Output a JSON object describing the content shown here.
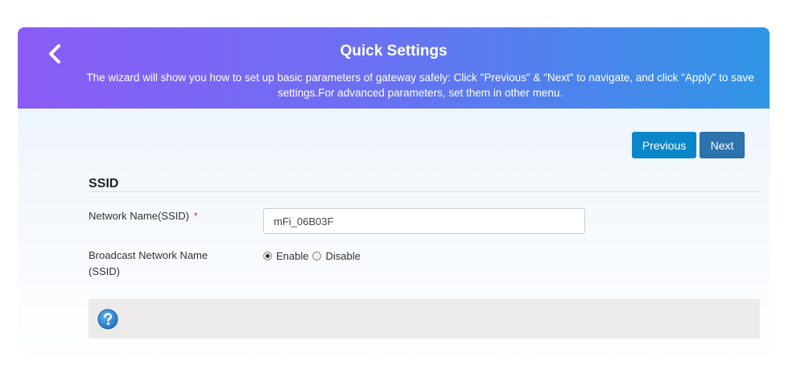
{
  "header": {
    "title": "Quick Settings",
    "description": "The wizard will show you how to set up basic parameters of gateway safely: Click \"Previous\" & \"Next\" to navigate, and click \"Apply\" to save settings.For advanced parameters, set them in other menu.",
    "back_icon": "chevron-left-icon"
  },
  "nav": {
    "previous_label": "Previous",
    "next_label": "Next"
  },
  "section": {
    "title": "SSID"
  },
  "form": {
    "ssid_label": "Network Name(SSID)",
    "required_mark": "*",
    "ssid_value": "mFi_06B03F",
    "broadcast_label": "Broadcast Network Name (SSID)",
    "broadcast_options": [
      "Enable",
      "Disable"
    ],
    "broadcast_selected": "Enable"
  },
  "help": {
    "icon": "question-circle-icon"
  },
  "colors": {
    "header_gradient_start": "#8a5cf5",
    "header_gradient_end": "#2f95e6",
    "previous_button": "#0b86c9",
    "next_button": "#2d73ad",
    "required": "#e0322f",
    "help_icon": "#1f7fd0"
  }
}
